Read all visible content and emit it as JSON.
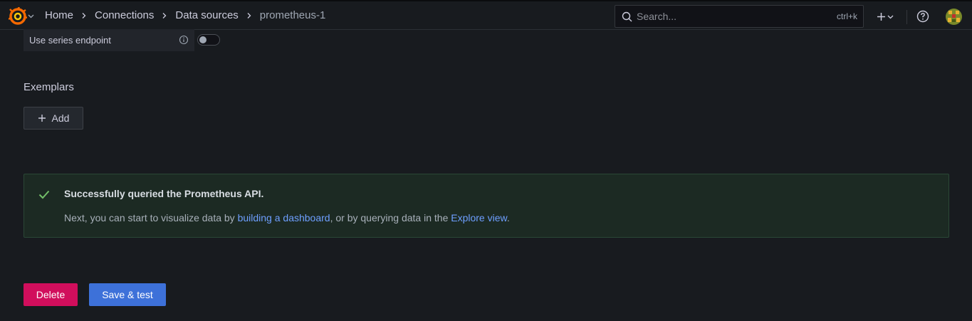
{
  "topbar": {
    "breadcrumbs": [
      "Home",
      "Connections",
      "Data sources",
      "prometheus-1"
    ],
    "search": {
      "placeholder": "Search...",
      "shortcut": "ctrl+k"
    }
  },
  "settings": {
    "use_series_endpoint_label": "Use series endpoint",
    "use_series_endpoint_enabled": false
  },
  "exemplars": {
    "title": "Exemplars",
    "add_label": "Add"
  },
  "alert": {
    "title": "Successfully queried the Prometheus API.",
    "body_prefix": "Next, you can start to visualize data by ",
    "link_dashboard": "building a dashboard",
    "body_middle": ", or by querying data in the ",
    "link_explore": "Explore view",
    "body_suffix": ".",
    "status_color": "#73bf69"
  },
  "actions": {
    "delete_label": "Delete",
    "save_label": "Save & test"
  },
  "colors": {
    "background": "#181b1f",
    "delete": "#d10e5c",
    "primary": "#3d71d9",
    "link": "#6e9fff"
  }
}
